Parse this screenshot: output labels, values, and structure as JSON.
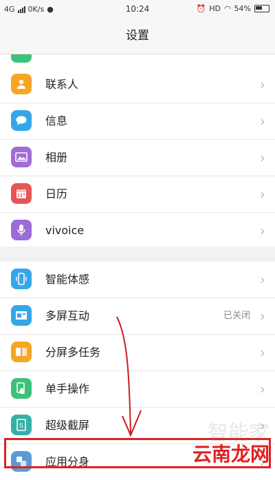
{
  "status_bar": {
    "network": "4G",
    "speed": "0K/s",
    "time": "10:24",
    "hd": "HD",
    "battery": "54%"
  },
  "header": {
    "title": "设置"
  },
  "section1": {
    "items": [
      {
        "label": "联系人",
        "icon": "contacts-icon",
        "color": "#f5a623"
      },
      {
        "label": "信息",
        "icon": "messages-icon",
        "color": "#35a7e8"
      },
      {
        "label": "相册",
        "icon": "album-icon",
        "color": "#a06cd5"
      },
      {
        "label": "日历",
        "icon": "calendar-icon",
        "color": "#e85555"
      },
      {
        "label": "vivoice",
        "icon": "microphone-icon",
        "color": "#9b6bd6"
      }
    ]
  },
  "section2": {
    "items": [
      {
        "label": "智能体感",
        "icon": "phone-sensor-icon",
        "color": "#35a7e8"
      },
      {
        "label": "多屏互动",
        "value": "已关闭",
        "icon": "multiscreen-icon",
        "color": "#35a7e8"
      },
      {
        "label": "分屏多任务",
        "icon": "split-screen-icon",
        "color": "#f5a623"
      },
      {
        "label": "单手操作",
        "icon": "one-hand-icon",
        "color": "#3cc27a"
      },
      {
        "label": "超级截屏",
        "icon": "screenshot-icon",
        "color": "#35b0a8"
      },
      {
        "label": "应用分身",
        "icon": "app-clone-icon",
        "color": "#5b9bd5"
      }
    ]
  },
  "watermark": {
    "ghost": "智能家",
    "text": "云南龙网"
  }
}
